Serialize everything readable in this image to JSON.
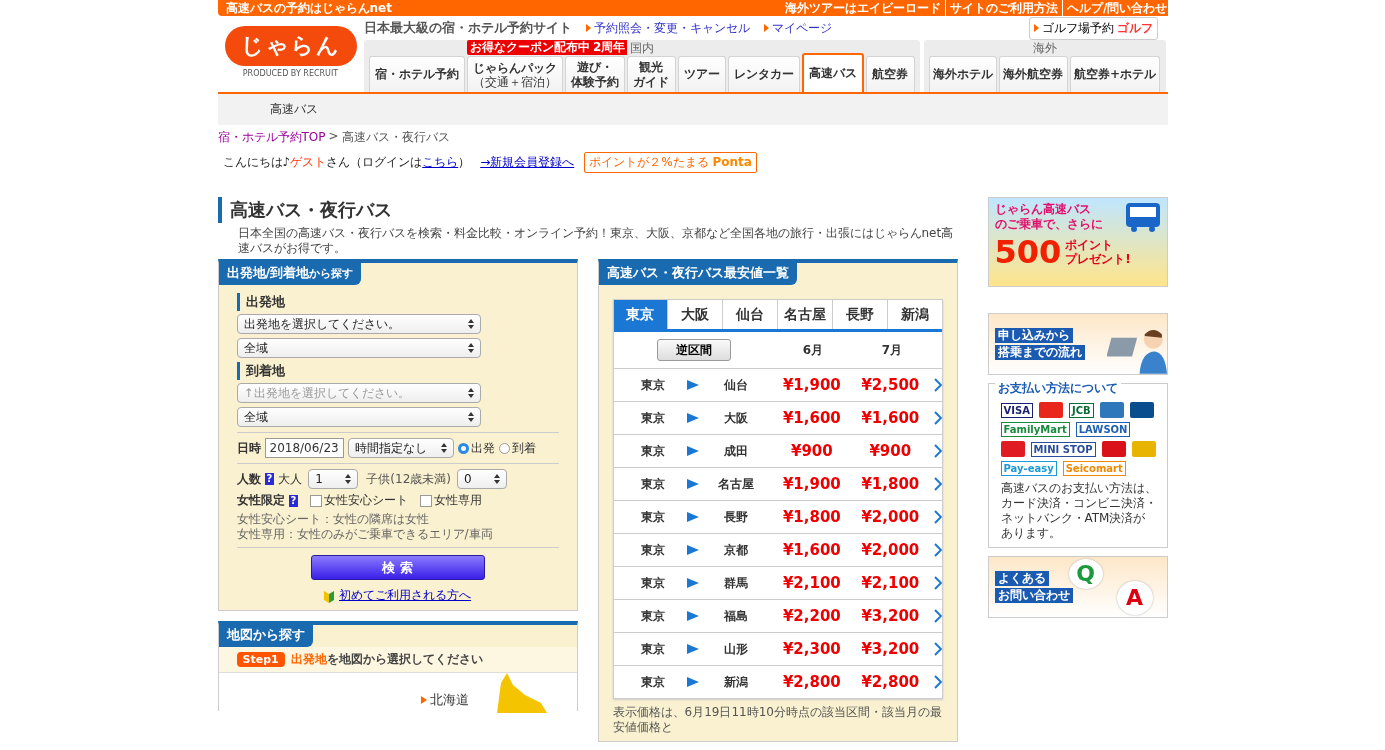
{
  "top_bar": {
    "title": "高速バスの予約はじゃらんnet",
    "links": [
      "海外ツアーはエイビーロード",
      "サイトのご利用方法",
      "ヘルプ/問い合わせ"
    ]
  },
  "logo": {
    "text": "じゃらん",
    "credit": "PRODUCED BY RECRUIT"
  },
  "tagline": "日本最大級の宿・ホテル予約サイト",
  "header_links": [
    "予約照会・変更・キャンセル",
    "マイページ"
  ],
  "golf_button": {
    "label": "ゴルフ場予約",
    "logo": "ゴルフ"
  },
  "nav_groups": [
    {
      "label": "国内",
      "tabs": [
        {
          "lines": [
            "宿・ホテル予約"
          ],
          "selected": false
        },
        {
          "lines": [
            "じゃらんパック",
            "（交通＋宿泊）"
          ],
          "selected": false,
          "badge": "お得なクーポン配布中"
        },
        {
          "lines": [
            "遊び・",
            "体験予約"
          ],
          "selected": false,
          "ribbon": "2周年"
        },
        {
          "lines": [
            "観光",
            "ガイド"
          ],
          "selected": false
        },
        {
          "lines": [
            "ツアー"
          ],
          "selected": false
        },
        {
          "lines": [
            "レンタカー"
          ],
          "selected": false
        },
        {
          "lines": [
            "高速バス"
          ],
          "selected": true
        },
        {
          "lines": [
            "航空券"
          ],
          "selected": false
        }
      ]
    },
    {
      "label": "海外",
      "tabs": [
        {
          "lines": [
            "海外ホテル"
          ],
          "selected": false
        },
        {
          "lines": [
            "海外航空券"
          ],
          "selected": false
        },
        {
          "lines": [
            "航空券+ホテル"
          ],
          "selected": false
        }
      ]
    }
  ],
  "subnav_item": "高速バス",
  "breadcrumb": {
    "items": [
      "宿・ホテル予約TOP",
      "高速バス・夜行バス"
    ],
    "separator": ">"
  },
  "greeting": {
    "prefix": "こんにちは♪",
    "guest": "ゲスト",
    "suffix": "さん",
    "login_prefix": "（ログインは",
    "login_link": "こちら",
    "login_suffix": "）"
  },
  "register_link": "→新規会員登録へ",
  "ponta": {
    "text": "ポイントが２%たまる",
    "logo": "Ponta"
  },
  "page_title": "高速バス・夜行バス",
  "description": "日本全国の高速バス・夜行バスを検索・料金比較・オンライン予約！東京、大阪、京都など全国各地の旅行・出張にはじゃらんnet高速バスがお得です。",
  "search_panel": {
    "title": "出発地/到着地",
    "title_suffix": "から探す",
    "departure": {
      "label": "出発地",
      "selects": [
        {
          "value": "出発地を選択してください。",
          "disabled": false
        },
        {
          "value": "全域",
          "disabled": false
        }
      ]
    },
    "arrival": {
      "label": "到着地",
      "selects": [
        {
          "value": "↑出発地を選択してください。",
          "disabled": true
        },
        {
          "value": "全域",
          "disabled": false
        }
      ]
    },
    "date": {
      "label": "日時",
      "value": "2018/06/23",
      "time": "時間指定なし",
      "options": [
        {
          "label": "出発",
          "selected": true
        },
        {
          "label": "到着",
          "selected": false
        }
      ]
    },
    "people": {
      "label": "人数",
      "help": "?",
      "adult_label": "大人",
      "adult": "1",
      "child_label": "子供",
      "child_note": "(12歳未満)",
      "child": "0"
    },
    "women": {
      "label": "女性限定",
      "help": "?",
      "options": [
        {
          "label": "女性安心シート",
          "checked": false
        },
        {
          "label": "女性専用",
          "checked": false
        }
      ]
    },
    "notes": [
      "女性安心シート：女性の隣席は女性",
      "女性専用：女性のみがご乗車できるエリア/車両"
    ],
    "button": "検 索",
    "first_time_link": "初めてご利用される方へ"
  },
  "map_panel": {
    "title": "地図から探す",
    "step": "Step1",
    "instruction_highlight": "出発地",
    "instruction": "を地図から選択してください",
    "region": "北海道"
  },
  "fare_table": {
    "title": "高速バス・夜行バス最安値一覧",
    "cities": [
      {
        "label": "東京",
        "selected": true
      },
      {
        "label": "大阪",
        "selected": false
      },
      {
        "label": "仙台",
        "selected": false
      },
      {
        "label": "名古屋",
        "selected": false
      },
      {
        "label": "長野",
        "selected": false
      },
      {
        "label": "新潟",
        "selected": false
      }
    ],
    "reverse_button": "逆区間",
    "months": [
      "6月",
      "7月"
    ],
    "rows": [
      {
        "from": "東京",
        "to": "仙台",
        "prices": [
          "¥1,900",
          "¥2,500"
        ]
      },
      {
        "from": "東京",
        "to": "大阪",
        "prices": [
          "¥1,600",
          "¥1,600"
        ]
      },
      {
        "from": "東京",
        "to": "成田",
        "prices": [
          "¥900",
          "¥900"
        ]
      },
      {
        "from": "東京",
        "to": "名古屋",
        "prices": [
          "¥1,900",
          "¥1,800"
        ]
      },
      {
        "from": "東京",
        "to": "長野",
        "prices": [
          "¥1,800",
          "¥2,000"
        ]
      },
      {
        "from": "東京",
        "to": "京都",
        "prices": [
          "¥1,600",
          "¥2,000"
        ]
      },
      {
        "from": "東京",
        "to": "群馬",
        "prices": [
          "¥2,100",
          "¥2,100"
        ]
      },
      {
        "from": "東京",
        "to": "福島",
        "prices": [
          "¥2,200",
          "¥3,200"
        ]
      },
      {
        "from": "東京",
        "to": "山形",
        "prices": [
          "¥2,300",
          "¥3,200"
        ]
      },
      {
        "from": "東京",
        "to": "新潟",
        "prices": [
          "¥2,800",
          "¥2,800"
        ]
      }
    ],
    "footnote": "表示価格は、6月19日11時10分時点の該当区間・該当月の最安値価格と"
  },
  "points_banner": {
    "lines": [
      "じゃらん高速バス",
      "のご乗車で、さらに"
    ],
    "amount": "500",
    "unit": "ポイント",
    "action": "プレゼント!"
  },
  "flow_banner": {
    "lines": [
      "申し込みから",
      "搭乗までの流れ"
    ]
  },
  "payment": {
    "title": "お支払い方法について",
    "logos": [
      {
        "kind": "text",
        "label": "VISA",
        "color": "#1a1f71"
      },
      {
        "kind": "mark",
        "color": "#e8261c"
      },
      {
        "kind": "text",
        "label": "JCB",
        "color": "#0b6c3a"
      },
      {
        "kind": "mark",
        "color": "#2e77bb"
      },
      {
        "kind": "mark",
        "color": "#0a4d8c"
      },
      {
        "kind": "text",
        "label": "FamilyMart",
        "color": "#1a8a3c"
      },
      {
        "kind": "text",
        "label": "LAWSON",
        "color": "#1f5fb0"
      },
      {
        "kind": "mark",
        "color": "#e01b22"
      },
      {
        "kind": "text",
        "label": "MINI STOP",
        "color": "#2a4c9c"
      },
      {
        "kind": "mark",
        "color": "#d9121a"
      },
      {
        "kind": "mark",
        "color": "#e8b400"
      },
      {
        "kind": "text",
        "label": "Pay-easy",
        "color": "#1a9ad6"
      },
      {
        "kind": "text",
        "label": "Seicomart",
        "color": "#f08a00"
      }
    ],
    "text": "高速バスのお支払い方法は、カード決済・コンビニ決済・ネットバンク・ATM決済があります。"
  },
  "faq_banner": {
    "lines": [
      "よくある",
      "お問い合わせ"
    ],
    "question": "Q",
    "answer": "A"
  }
}
